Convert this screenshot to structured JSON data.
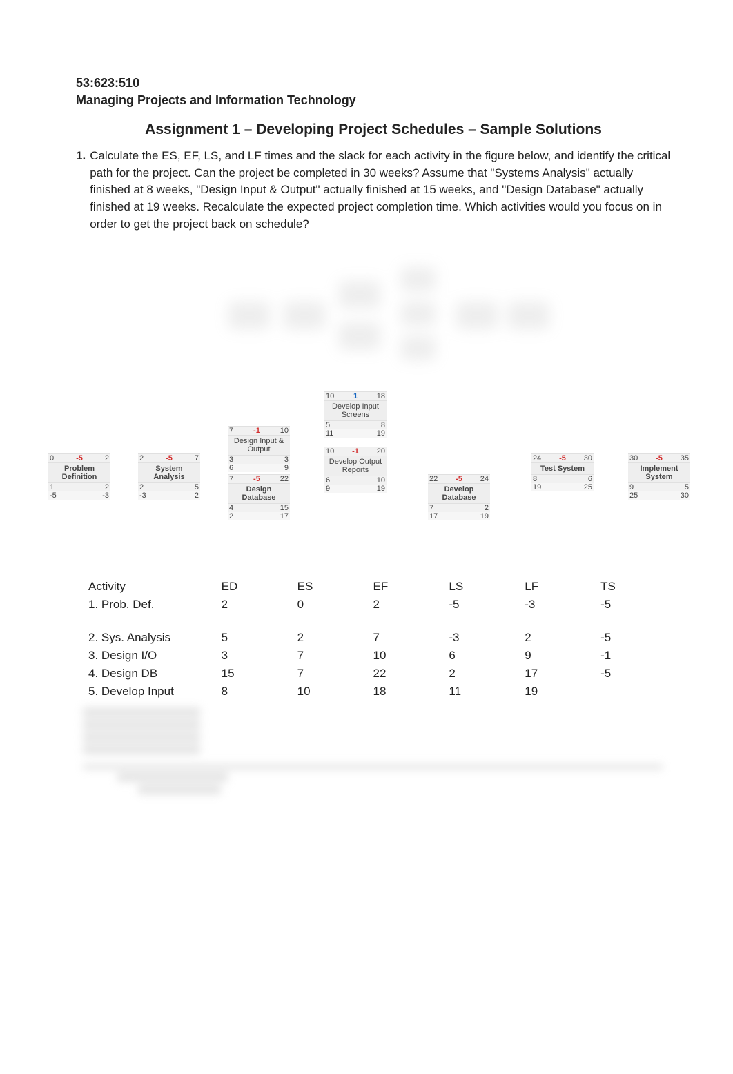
{
  "header": {
    "course_code": "53:623:510",
    "course_title": "Managing Projects and Information Technology"
  },
  "assignment_title": "Assignment 1 – Developing Project Schedules – Sample Solutions",
  "question": {
    "number": "1.",
    "text": "Calculate the ES, EF, LS, and LF times and the slack for each activity in the figure below, and identify the critical path for the project. Can the project be completed in 30 weeks? Assume that \"Systems Analysis\" actually finished at 8 weeks, \"Design Input & Output\" actually finished at 15 weeks, and \"Design Database\" actually finished at 19 weeks. Recalculate the expected project completion time. Which activities would you focus on in order to get the project back on schedule?"
  },
  "network": {
    "problem_definition": {
      "es": "0",
      "dur": "-5",
      "ef": "2",
      "name": "Problem Definition",
      "ls": "1",
      "lf": "2",
      "r3l": "-5",
      "r3r": "-3"
    },
    "system_analysis": {
      "es": "2",
      "dur": "-5",
      "ef": "7",
      "name": "System Analysis",
      "ls": "2",
      "lf": "5",
      "r3l": "-3",
      "r3r": "2"
    },
    "design_io": {
      "es": "7",
      "dur": "-1",
      "ef": "10",
      "name": "Design Input & Output",
      "ls": "3",
      "lf": "3",
      "r3l": "6",
      "r3r": "9"
    },
    "design_db": {
      "es": "7",
      "dur": "-5",
      "ef": "22",
      "name": "Design Database",
      "ls": "4",
      "lf": "15",
      "r3l": "2",
      "r3r": "17"
    },
    "dev_input_screens": {
      "es": "10",
      "dur": "1",
      "ef": "18",
      "name": "Develop Input Screens",
      "ls": "5",
      "lf": "8",
      "r3l": "11",
      "r3r": "19"
    },
    "dev_output_reports": {
      "es": "10",
      "dur": "-1",
      "ef": "20",
      "name": "Develop Output Reports",
      "ls": "6",
      "lf": "10",
      "r3l": "9",
      "r3r": "19"
    },
    "develop_database": {
      "es": "22",
      "dur": "-5",
      "ef": "24",
      "name": "Develop Database",
      "ls": "7",
      "lf": "2",
      "r3l": "17",
      "r3r": "19"
    },
    "test_system": {
      "es": "24",
      "dur": "-5",
      "ef": "30",
      "name": "Test System",
      "ls": "8",
      "lf": "6",
      "r3l": "19",
      "r3r": "25"
    },
    "implement_system": {
      "es": "30",
      "dur": "-5",
      "ef": "35",
      "name": "Implement System",
      "ls": "9",
      "lf": "5",
      "r3l": "25",
      "r3r": "30"
    }
  },
  "activity_table": {
    "columns": [
      "Activity",
      "ED",
      "ES",
      "EF",
      "LS",
      "LF",
      "TS"
    ],
    "rows": [
      {
        "activity": "1. Prob. Def.",
        "ed": "2",
        "es": "0",
        "ef": "2",
        "ls": "-5",
        "lf": "-3",
        "ts": "-5"
      },
      {
        "activity": "2. Sys. Analysis",
        "ed": "5",
        "es": "2",
        "ef": "7",
        "ls": "-3",
        "lf": "2",
        "ts": "-5"
      },
      {
        "activity": "3. Design I/O",
        "ed": "3",
        "es": "7",
        "ef": "10",
        "ls": "6",
        "lf": "9",
        "ts": "-1"
      },
      {
        "activity": "4. Design DB",
        "ed": "15",
        "es": "7",
        "ef": "22",
        "ls": "2",
        "lf": "17",
        "ts": "-5"
      },
      {
        "activity": "5. Develop Input",
        "ed": "8",
        "es": "10",
        "ef": "18",
        "ls": "11",
        "lf": "19",
        "ts": ""
      }
    ]
  }
}
